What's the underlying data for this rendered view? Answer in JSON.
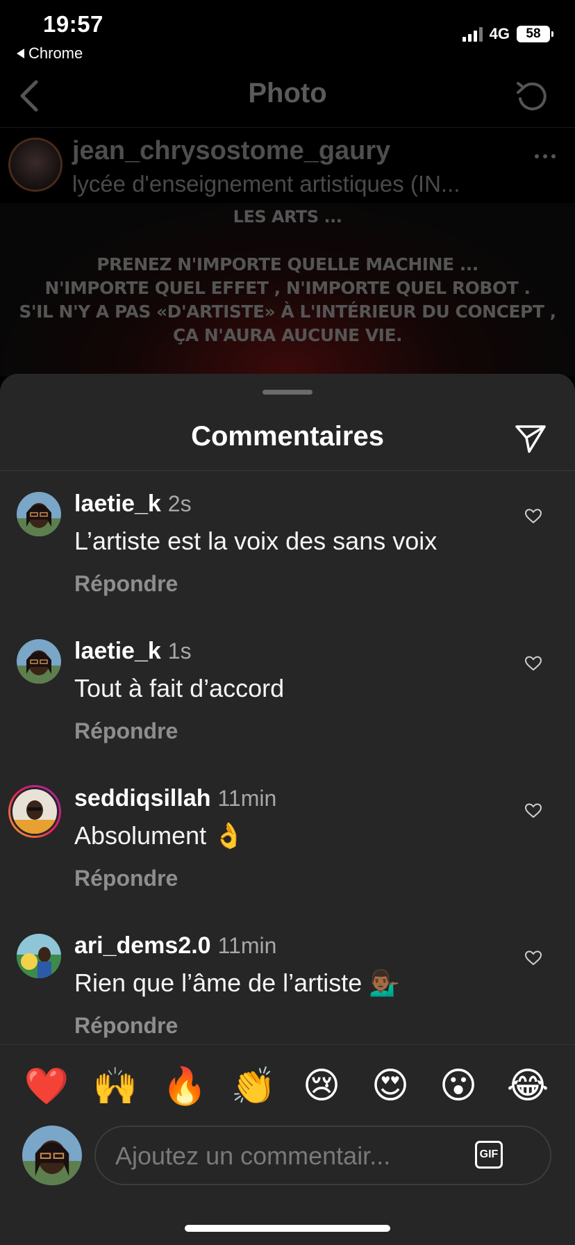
{
  "status_bar": {
    "time": "19:57",
    "back_app": "Chrome",
    "network": "4G",
    "battery": "58"
  },
  "nav": {
    "title": "Photo"
  },
  "post": {
    "username": "jean_chrysostome_gaury",
    "location": "lycée d'enseignement artistiques (IN..."
  },
  "poster": {
    "lines": [
      "LES ARTS ...",
      "PRENEZ N'IMPORTE QUELLE MACHINE ...",
      "N'IMPORTE QUEL EFFET , N'IMPORTE QUEL ROBOT .",
      "S'IL N'Y A PAS «D'ARTISTE» À L'INTÉRIEUR DU CONCEPT ,",
      "ÇA N'AURA AUCUNE VIE."
    ]
  },
  "comments_sheet": {
    "title": "Commentaires",
    "reply_label": "Répondre",
    "comments": [
      {
        "username": "laetie_k",
        "time": "2s",
        "text": "L’artiste est la voix des sans voix"
      },
      {
        "username": "laetie_k",
        "time": "1s",
        "text": "Tout à fait d’accord"
      },
      {
        "username": "seddiqsillah",
        "time": "11min",
        "text": "Absolument 👌"
      },
      {
        "username": "ari_dems2.0",
        "time": "11min",
        "text": "Rien que l’âme de l’artiste 💁🏾‍♂️"
      }
    ]
  },
  "emoji_bar": [
    "❤️",
    "🙌",
    "🔥",
    "👏",
    "😢",
    "😍",
    "😮",
    "😂"
  ],
  "input": {
    "placeholder": "Ajoutez un commentair...",
    "gif_label": "GIF"
  },
  "colors": {
    "sheet_bg": "#262626",
    "story_ring_start": "#f9a825",
    "story_ring_end": "#9c27b0"
  }
}
